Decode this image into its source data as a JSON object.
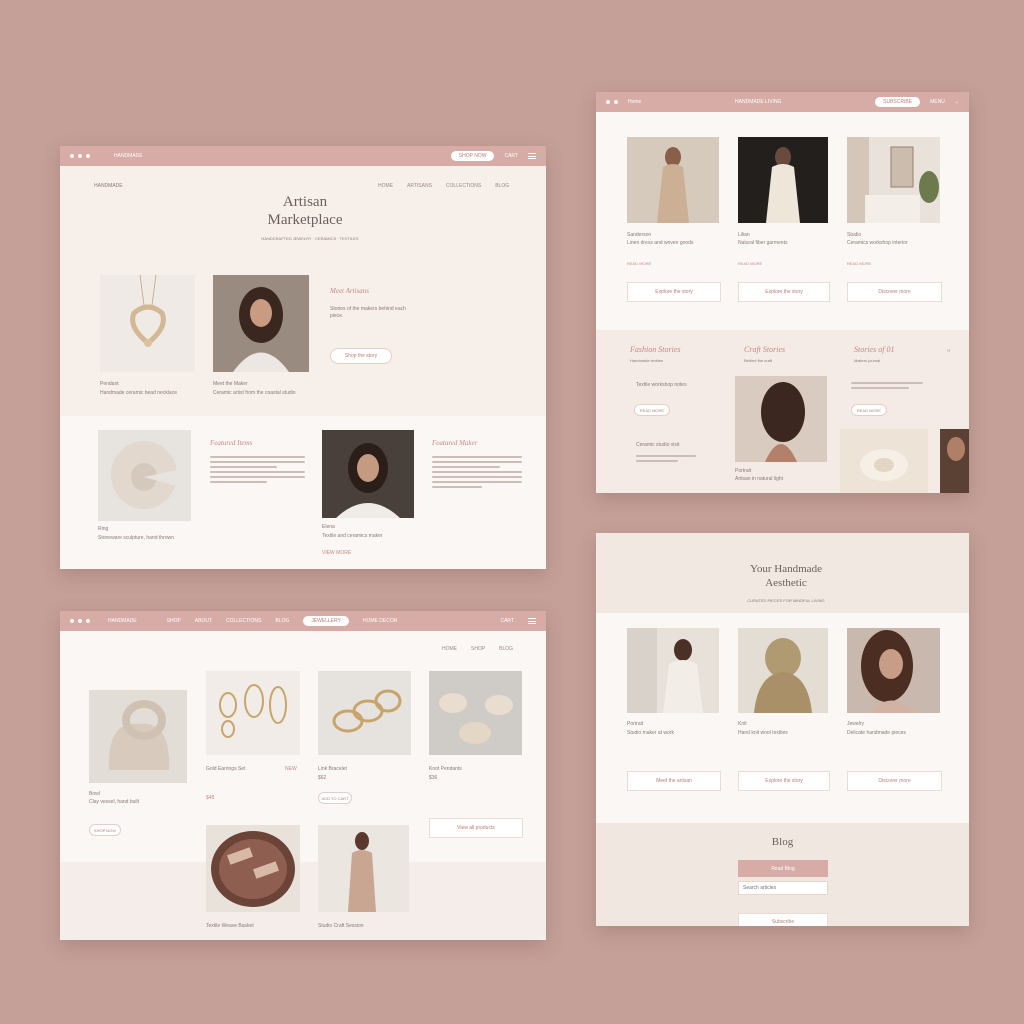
{
  "mockA": {
    "topbar": {
      "brand": "HANDMADE",
      "pill": "SHOP NOW",
      "link": "CART"
    },
    "nav": [
      "HOME",
      "ARTISANS",
      "COLLECTIONS",
      "BLOG"
    ],
    "logo": "HANDMADE",
    "hero_title_1": "Artisan",
    "hero_title_2": "Marketplace",
    "hero_sub": "HANDCRAFTED JEWELRY · CERAMICS · TEXTILES",
    "products": [
      {
        "name": "Pendant",
        "desc": "Handmade ceramic bead necklace"
      },
      {
        "name": "Meet the Maker",
        "desc": "Ceramic artist from the coastal studio"
      }
    ],
    "feature": {
      "title": "Meet Artisans",
      "body": "Stories of the makers behind each piece.",
      "button": "Shop the story"
    },
    "row2": [
      {
        "title": "Featured Items",
        "name": "Ring",
        "desc": "Stoneware sculpture, hand thrown"
      },
      {
        "title": "Featured Maker",
        "name": "Elena",
        "desc": "Textile and ceramics maker",
        "link": "VIEW MORE"
      }
    ]
  },
  "mockB": {
    "topbar": {
      "brand": "Home",
      "center": "HANDMADE LIVING",
      "pill": "SUBSCRIBE",
      "link": "MENU"
    },
    "cards": [
      {
        "name": "Sanderson",
        "desc": "Linen dress and woven goods",
        "link": "READ MORE",
        "button": "Explore the story"
      },
      {
        "name": "Lilian",
        "desc": "Natural fiber garments",
        "link": "READ MORE",
        "button": "Explore the story"
      },
      {
        "name": "Studio",
        "desc": "Ceramics workshop interior",
        "link": "READ MORE",
        "button": "Discover more"
      }
    ],
    "section": [
      {
        "title": "Fashion Stories",
        "sub": "Handmade textiles"
      },
      {
        "title": "Craft Stories",
        "sub": "Behind the craft"
      },
      {
        "title": "Stories of 01",
        "sub": "Makers journal"
      }
    ],
    "list": [
      "Textile workshop notes",
      "Ceramic studio visit"
    ],
    "small_button": "READ MORE",
    "caption": {
      "name": "Portrait",
      "desc": "Artisan in natural light"
    }
  },
  "mockC": {
    "topbar": {
      "brand": "HANDMADE",
      "nav": [
        "SHOP",
        "ABOUT",
        "COLLECTIONS",
        "BLOG",
        "JEWELLERY",
        "HOME DECOR"
      ],
      "link": "CART"
    },
    "subnav": [
      "HOME",
      "SHOP",
      "BLOG"
    ],
    "feature": {
      "name": "Bowl",
      "desc": "Clay vessel, hand built",
      "button": "SHOP NOW"
    },
    "items": [
      {
        "title": "Gold Earrings Set",
        "tag": "NEW",
        "price": "$48"
      },
      {
        "title": "Link Bracelet",
        "price": "$62",
        "button": "ADD TO CART"
      },
      {
        "title": "Knot Pendants",
        "price": "$36"
      }
    ],
    "button2": "View all products",
    "bottom": [
      {
        "title": "Textile Weave Basket"
      },
      {
        "title": "Studio Craft Session"
      }
    ]
  },
  "mockD": {
    "title_1": "Your Handmade",
    "title_2": "Aesthetic",
    "sub": "CURATED PIECES FOR MINDFUL LIVING",
    "cards": [
      {
        "name": "Portrait",
        "desc": "Studio maker at work",
        "button": "Meet the artisan"
      },
      {
        "name": "Knit",
        "desc": "Hand knit wool textiles",
        "button": "Explore the story"
      },
      {
        "name": "Jewelry",
        "desc": "Delicate handmade pieces",
        "button": "Discover more"
      }
    ],
    "blog_title": "Blog",
    "blog_button": "Read Blog",
    "search_placeholder": "Search articles",
    "footer_button": "Subscribe"
  }
}
